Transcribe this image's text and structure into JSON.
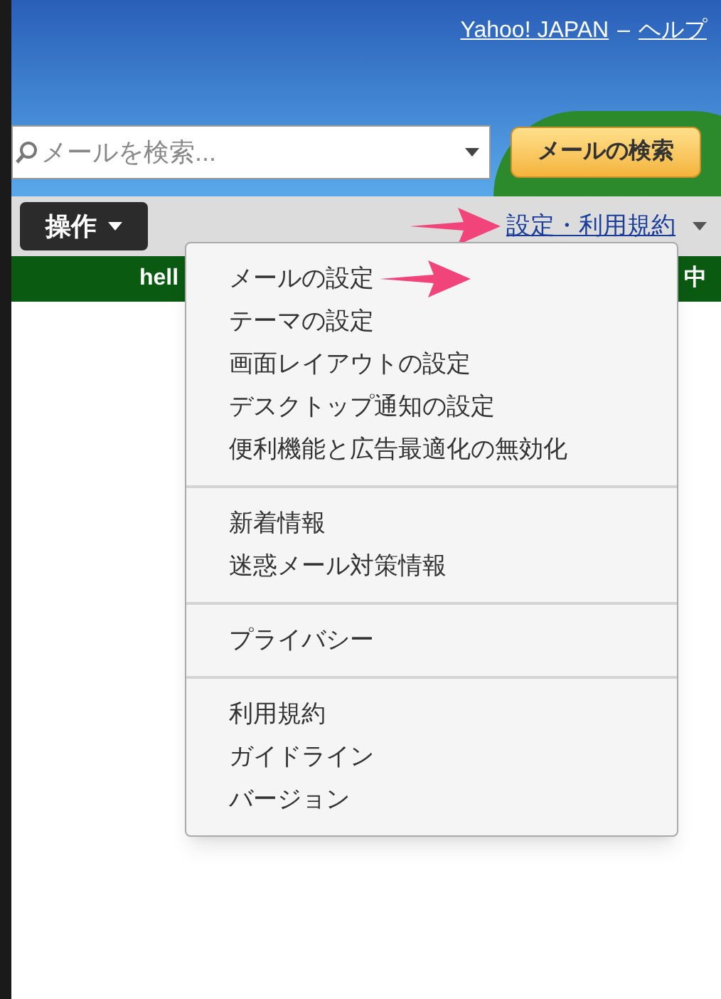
{
  "header": {
    "links": [
      "Yahoo! JAPAN",
      "ヘルプ"
    ],
    "separator": "–"
  },
  "search": {
    "placeholder": "メールを検索...",
    "button": "メールの検索"
  },
  "toolbar": {
    "action_button": "操作",
    "settings_link": "設定・利用規約"
  },
  "banner": {
    "left_text": "hell",
    "right_text": "中"
  },
  "menu": {
    "groups": [
      {
        "items": [
          "メールの設定",
          "テーマの設定",
          "画面レイアウトの設定",
          "デスクトップ通知の設定",
          "便利機能と広告最適化の無効化"
        ]
      },
      {
        "items": [
          "新着情報",
          "迷惑メール対策情報"
        ]
      },
      {
        "items": [
          "プライバシー"
        ]
      },
      {
        "items": [
          "利用規約",
          "ガイドライン",
          "バージョン"
        ]
      }
    ]
  }
}
